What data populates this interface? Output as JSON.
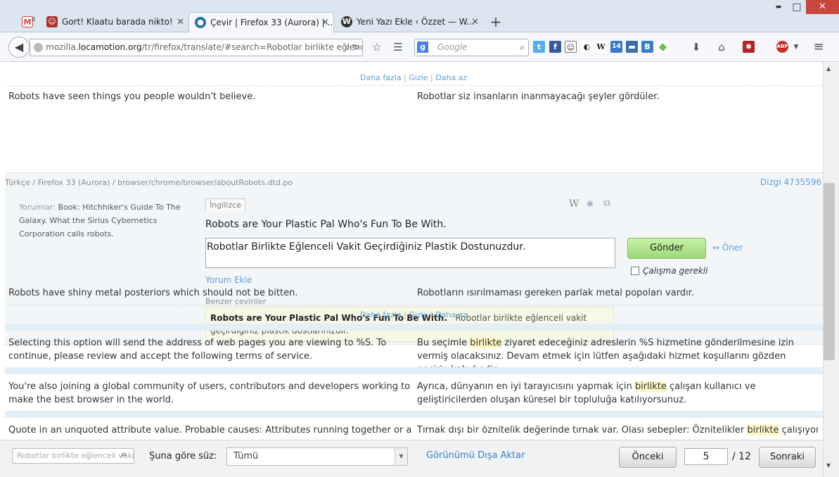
{
  "window": {
    "minimize": "▬",
    "maximize": "□",
    "close": "✕"
  },
  "tabs": [
    {
      "icon": "gmail-icon",
      "label": "",
      "badge": "0"
    },
    {
      "icon": "robot-icon",
      "label": "Gort! Klaatu barada nikto!"
    },
    {
      "icon": "firefox-icon",
      "label": "Çevir | Firefox 33 (Aurora) | ..."
    },
    {
      "icon": "wordpress-icon",
      "label": "Yeni Yazı Ekle ‹ Özzet — W..."
    }
  ],
  "tab_close": "✕",
  "newtab": "+",
  "url": {
    "prefix": "mozilla.",
    "domain": "locamotion.org",
    "path": "/tr/firefox/translate/#search=Robotlar birlikte eğlence"
  },
  "search": {
    "engine": "g",
    "placeholder": "Google"
  },
  "content": {
    "prev_links": {
      "more": "Daha fazla",
      "hide": "Gizle",
      "less": "Daha az",
      "sep": "|"
    },
    "row1": {
      "source": "Robots have seen things you people wouldn't believe.",
      "target": "Robotlar siz insanların inanmayacağı şeyler gördüler."
    },
    "breadcrumb": "Türkçe / Firefox 33 (Aurora) / browser/chrome/browser/aboutRobots.dtd.po",
    "string_id": "Dizgi 4735596",
    "comment_label": "Yorumlar:",
    "comment_text": "Book: Hitchhiker's Guide To The Galaxy. What the Sirius Cybernetics Corporation calls robots.",
    "source_lang": "İngilizce",
    "source_text": "Robots are Your Plastic Pal Who's Fun To Be With.",
    "translation_value": "Robotlar Birlikte Eğlenceli Vakit Geçirdiğiniz Plastik Dostunuzdur.",
    "submit": "Gönder",
    "suggest": "↔ Öner",
    "fuzzy": "Çalışma gerekli",
    "add_comment": "Yorum Ekle",
    "similar_label": "Benzer çeviriler",
    "similar_source": "Robots are Your Plastic Pal Who's Fun To Be With.",
    "similar_target": "Robotlar birlikte eğlenceli vakit geçirdiğiniz plastik dostlarınızdır.",
    "row2": {
      "source": "Robots have shiny metal posteriors which should not be bitten.",
      "target": "Robotların ısırılmaması gereken parlak metal popoları vardır."
    },
    "row3": {
      "source": "Selecting this option will send the address of web pages you are viewing to %S. To continue, please review and accept the following terms of service.",
      "target_pre": "Bu seçimle ",
      "target_hl": "birlikte",
      "target_post": " ziyaret edeceğiniz adreslerin %S hizmetine gönderilmesine izin vermiş olacaksınız. Devam etmek için lütfen aşağıdaki hizmet koşullarını gözden geçirip kabul edin."
    },
    "row4": {
      "source": "You're also joining a global community of users, contributors and developers working to make the best browser in the world.",
      "target_pre": "Ayrıca, dünyanın en iyi tarayıcısını yapmak için ",
      "target_hl": "birlikte",
      "target_post": " çalışan kullanıcı ve geliştiricilerden oluşan küresel bir topluluğa katılıyorsunuz."
    },
    "row5": {
      "source": "Quote in an unquoted attribute value. Probable causes: Attributes running together or a URL",
      "target_pre": "Tırnak dışı bir öznitelik değerinde tırnak var. Olası sebepler: Öznitelikler ",
      "target_hl": "birlikte",
      "target_post": " çalışıyor veya"
    }
  },
  "footer": {
    "search_placeholder": "Robotlar birlikte eğlenceli vakit",
    "filter_label": "Şuna göre süz:",
    "filter_value": "Tümü",
    "export": "Görünümü Dışa Aktar",
    "prev": "Önceki",
    "page": "5",
    "total": "/ 12",
    "next": "Sonraki"
  }
}
